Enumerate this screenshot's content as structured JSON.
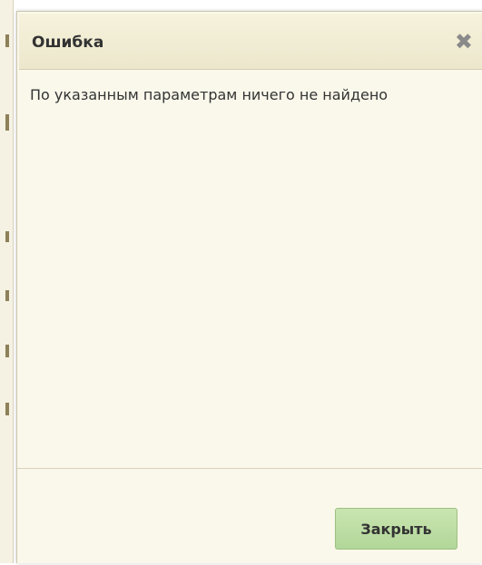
{
  "dialog": {
    "title": "Ошибка",
    "close_icon": "close-icon",
    "message": "По указанным параметрам ничего не найдено",
    "close_button_label": "Закрыть"
  },
  "colors": {
    "dialog_background": "#faf8eb",
    "header_background": "#ece7cc",
    "button_background": "#b2d69a",
    "text": "#333333",
    "close_icon": "#8a8a8a"
  }
}
